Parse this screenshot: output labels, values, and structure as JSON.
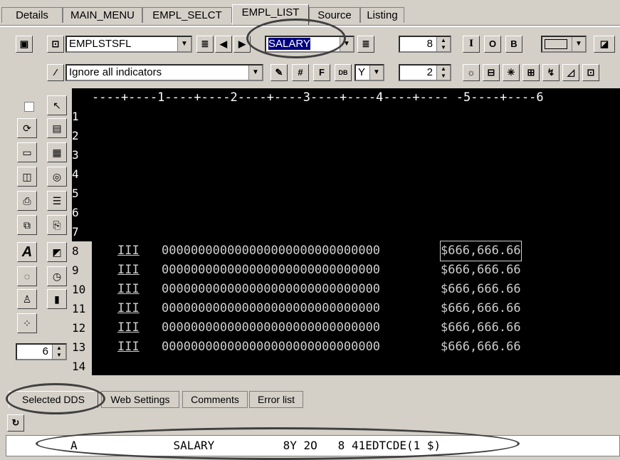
{
  "tabs": [
    "Details",
    "MAIN_MENU",
    "EMPL_SELCT",
    "EMPL_LIST",
    "Source",
    "Listing"
  ],
  "active_tab": "EMPL_LIST",
  "toolbar": {
    "record_combo": "EMPLSTSFL",
    "field_combo": "SALARY",
    "length_value": "8",
    "indicators_combo": "Ignore all indicators",
    "y_combo": "Y",
    "decimals_value": "2",
    "btn_I": "I",
    "btn_O": "O",
    "btn_B": "B"
  },
  "ruler": "----+----1----+----2----+----3----+----4----+---- -5----+----6",
  "line_numbers": [
    "1",
    "2",
    "3",
    "4",
    "5",
    "6",
    "7",
    "8",
    "9",
    "10",
    "11",
    "12",
    "13",
    "14"
  ],
  "rows": [
    {
      "line": "8",
      "ind": "III",
      "zeros": "000000000000000000000000000000",
      "salary": "$666,666.66"
    },
    {
      "line": "9",
      "ind": "III",
      "zeros": "000000000000000000000000000000",
      "salary": "$666,666.66"
    },
    {
      "line": "10",
      "ind": "III",
      "zeros": "000000000000000000000000000000",
      "salary": "$666,666.66"
    },
    {
      "line": "11",
      "ind": "III",
      "zeros": "000000000000000000000000000000",
      "salary": "$666,666.66"
    },
    {
      "line": "12",
      "ind": "III",
      "zeros": "000000000000000000000000000000",
      "salary": "$666,666.66"
    },
    {
      "line": "13",
      "ind": "III",
      "zeros": "000000000000000000000000000000",
      "salary": "$666,666.66"
    }
  ],
  "palette_spin_value": "6",
  "bottom_tabs": [
    "Selected DDS",
    "Web Settings",
    "Comments",
    "Error list"
  ],
  "dds_line": "A              SALARY          8Y 2O   8 41EDTCDE(1 $)",
  "icons": {
    "refresh": "refresh-icon",
    "pointer": "pointer-icon",
    "text": "text-icon"
  }
}
